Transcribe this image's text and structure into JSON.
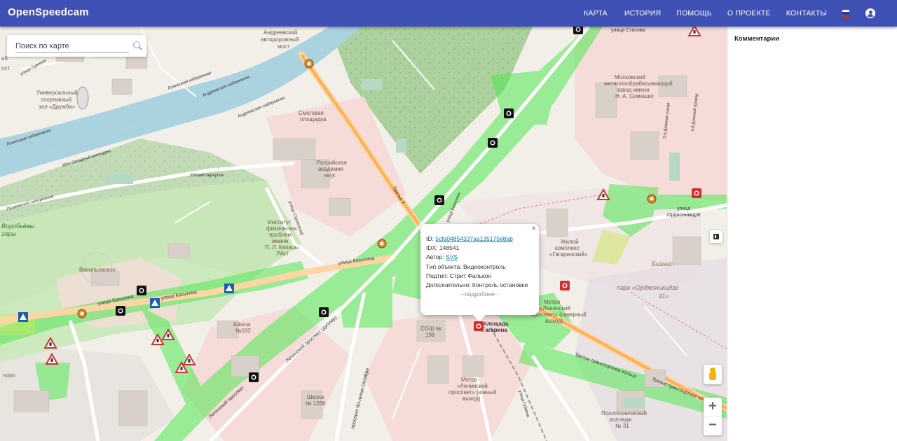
{
  "app": {
    "title": "OpenSpeedcam"
  },
  "nav": {
    "items": [
      "КАРТА",
      "ИСТОРИЯ",
      "ПОМОЩЬ",
      "О ПРОЕКТЕ",
      "КОНТАКТЫ"
    ],
    "flag_colors": [
      "#ffffff",
      "#1c3fa8",
      "#d52b1e"
    ]
  },
  "search": {
    "placeholder": "Поиск по карте"
  },
  "sidebar": {
    "title": "Комментарии"
  },
  "popup": {
    "id_label": "ID:",
    "id_value": "5cfa04854337aa135175e8ab",
    "idx_label": "IDX:",
    "idx_value": "148541",
    "author_label": "Автор:",
    "author_value": "SVS",
    "type_label": "Тип объекта:",
    "type_value": "Видеоконтроль",
    "subtype_label": "Подтип:",
    "subtype_value": "Стрит Фалькон",
    "extra_label": "Дополнительно:",
    "extra_value": "Контроль остановки",
    "more": "--подробнее--",
    "close": "×"
  },
  "map": {
    "zoom_in": "+",
    "zoom_out": "−",
    "labels": {
      "andreevsky": "Андреевский",
      "andreevsky2": "автодорожный",
      "andreevsky3": "мост",
      "sports": "Универсальный",
      "sports2": "спортивный",
      "sports3": "зал «Дружба»",
      "smog": "Смоговая",
      "smog2": "площадка",
      "academy": "Российская",
      "academy2": "академия",
      "academy3": "наук",
      "institute": "Институт",
      "institute2": "физических",
      "institute3": "проблем",
      "institute4": "имени",
      "institute5": "П. Л. Капицы",
      "institute6": "РАН",
      "vorobyovy": "Воробьёвы",
      "vorobyovy2": "горы",
      "vasilyevskoe": "Васильевское",
      "kosygina": "улица Косыгина",
      "kosygina2": "улица Косыгина",
      "kosygina3": "улица Косыгина",
      "school192": "Школа",
      "school192b": "№192",
      "sosh": "СОШ №",
      "sosh2": "198",
      "school1266": "Школа",
      "school1266b": "№ 1266",
      "leninsky": "Ленинский проспект",
      "leninsky_ws": "Ленинский проспект (дублер)",
      "oktyabrya": "проспект 60-летия Октября",
      "third_ring": "Третье транспортное кольцо",
      "third_ring2": "Третье транспортное кольцо",
      "third_ring3": "Третье Т",
      "gagarin": "площадь",
      "gagarin2": "Гагарина",
      "business": "Бизнес-",
      "business2": "парк «Орджоникидзе",
      "business3": "11»",
      "ordzh": "улица",
      "ordzh2": "Орджоникидзе",
      "moskovsky": "Московский",
      "moskovsky2": "металлообрабатывающий",
      "moskovsky3": "завод имени",
      "moskovsky4": "Н. А. Семашко",
      "stasova": "улица Стасова",
      "metro": "Метро",
      "metro2": "«Ленинский",
      "metro3": "проспект» (южный",
      "metro4": "выход)",
      "metro_n": "Метро",
      "metro_n2": "«Ленинский",
      "metro_n3": "проспект» (северный",
      "metro_n4": "выход)",
      "polytech": "Политехнический",
      "polytech2": "колледж",
      "polytech3": "№ 31",
      "zhiloy": "Жилой",
      "zhiloy2": "комплекс",
      "zhiloy3": "«Гагаринский»",
      "luzh": "Лужнецкая набережная",
      "luzh2": "Лужнецкая набережная",
      "andr_nab": "Андреевская набережная",
      "andr_nab2": "Андреевская набережная",
      "pushk": "Пушкинская набережная",
      "zap": "Юго-Западный аппендикс",
      "eisk": "Ейский переулок",
      "stroitel": "улица Строителей",
      "vavilova": "улица Вавилова",
      "donskaya": "5-я Донская улица",
      "fourth_don": "4-й Донской проезд",
      "gubkina": "улица Губкина",
      "rst": "rston",
      "frag": "ий",
      "frag2": "ост",
      "ul_luzh": "улица Лужники"
    }
  }
}
